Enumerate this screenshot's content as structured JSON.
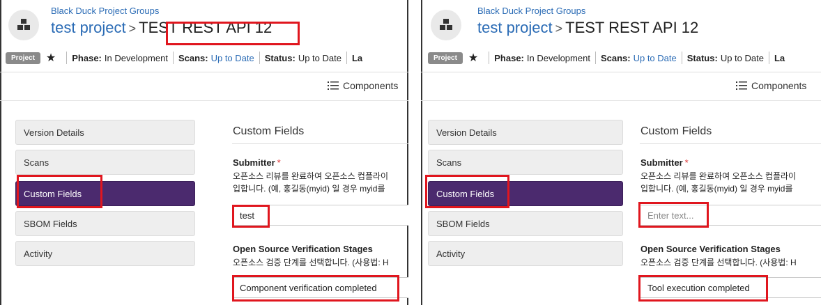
{
  "panels": [
    {
      "header": {
        "group_link": "Black Duck Project Groups",
        "project_name": "test project",
        "separator": ">",
        "version_name": "TEST REST API 12",
        "badge": "Project",
        "phase_label": "Phase:",
        "phase_value": "In Development",
        "scans_label": "Scans:",
        "scans_value": "Up to Date",
        "status_label": "Status:",
        "status_value": "Up to Date",
        "last_label": "La"
      },
      "toolbar": {
        "components_label": "Components"
      },
      "sidebar": {
        "items": [
          {
            "label": "Version Details"
          },
          {
            "label": "Scans"
          },
          {
            "label": "Custom Fields"
          },
          {
            "label": "SBOM Fields"
          },
          {
            "label": "Activity"
          }
        ]
      },
      "content": {
        "section_title": "Custom Fields",
        "submitter_label": "Submitter",
        "required_mark": "*",
        "submitter_desc_1": "오픈소스 리뷰를 완료하여 오픈소스 컴플라이",
        "submitter_desc_2": "입합니다. (예, 홍길동(myid) 일 경우 myid를",
        "submitter_value": "test",
        "stages_label": "Open Source Verification Stages",
        "stages_desc": "오픈소스 검증 단계를 선택합니다. (사용법: H",
        "stages_value": "Component verification completed"
      }
    },
    {
      "header": {
        "group_link": "Black Duck Project Groups",
        "project_name": "test project",
        "separator": ">",
        "version_name": "TEST REST API 12",
        "badge": "Project",
        "phase_label": "Phase:",
        "phase_value": "In Development",
        "scans_label": "Scans:",
        "scans_value": "Up to Date",
        "status_label": "Status:",
        "status_value": "Up to Date",
        "last_label": "La"
      },
      "toolbar": {
        "components_label": "Components"
      },
      "sidebar": {
        "items": [
          {
            "label": "Version Details"
          },
          {
            "label": "Scans"
          },
          {
            "label": "Custom Fields"
          },
          {
            "label": "SBOM Fields"
          },
          {
            "label": "Activity"
          }
        ]
      },
      "content": {
        "section_title": "Custom Fields",
        "submitter_label": "Submitter",
        "required_mark": "*",
        "submitter_desc_1": "오픈소스 리뷰를 완료하여 오픈소스 컴플라이",
        "submitter_desc_2": "입합니다. (예, 홍길동(myid) 일 경우 myid를",
        "submitter_placeholder": "Enter text...",
        "stages_label": "Open Source Verification Stages",
        "stages_desc": "오픈소스 검증 단계를 선택합니다. (사용법: H",
        "stages_value": "Tool execution completed"
      }
    }
  ],
  "colors": {
    "link": "#2a6bb5",
    "active_nav": "#4b2a6e",
    "highlight": "#e0161e"
  }
}
